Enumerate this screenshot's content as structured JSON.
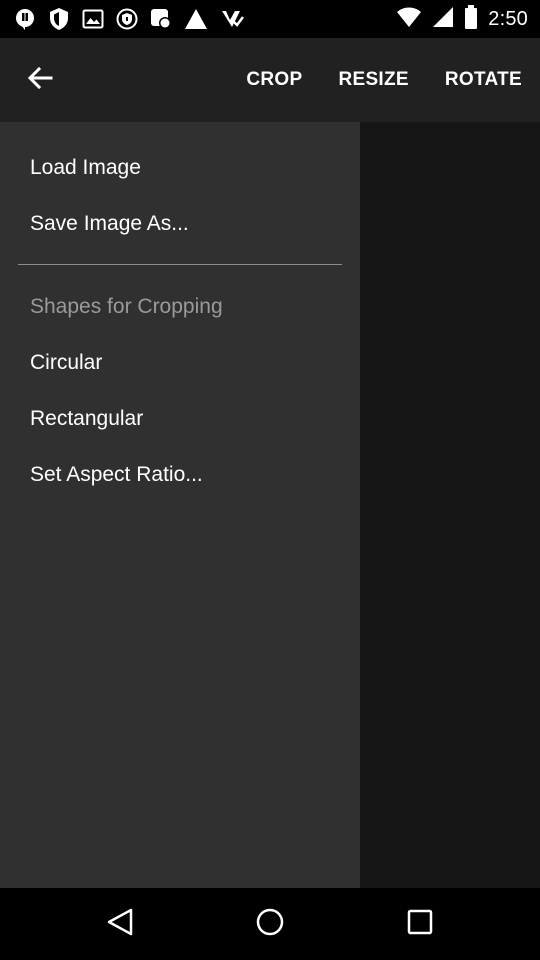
{
  "status_bar": {
    "time": "2:50",
    "icons_left": [
      "notification-icon",
      "shield-icon",
      "image-icon",
      "shield-small-icon",
      "badge-icon",
      "warning-icon",
      "checklist-icon"
    ],
    "icons_right": [
      "wifi-icon",
      "signal-icon",
      "battery-icon"
    ]
  },
  "toolbar": {
    "back_icon": "arrow-left-icon",
    "actions": [
      "CROP",
      "RESIZE",
      "ROTATE"
    ]
  },
  "menu": {
    "items_top": [
      "Load Image",
      "Save Image As..."
    ],
    "section_header": "Shapes for Cropping",
    "items_shapes": [
      "Circular",
      "Rectangular",
      "Set Aspect Ratio..."
    ]
  },
  "nav_bar": {
    "icons": [
      "back-triangle-icon",
      "home-circle-icon",
      "recents-square-icon"
    ]
  }
}
